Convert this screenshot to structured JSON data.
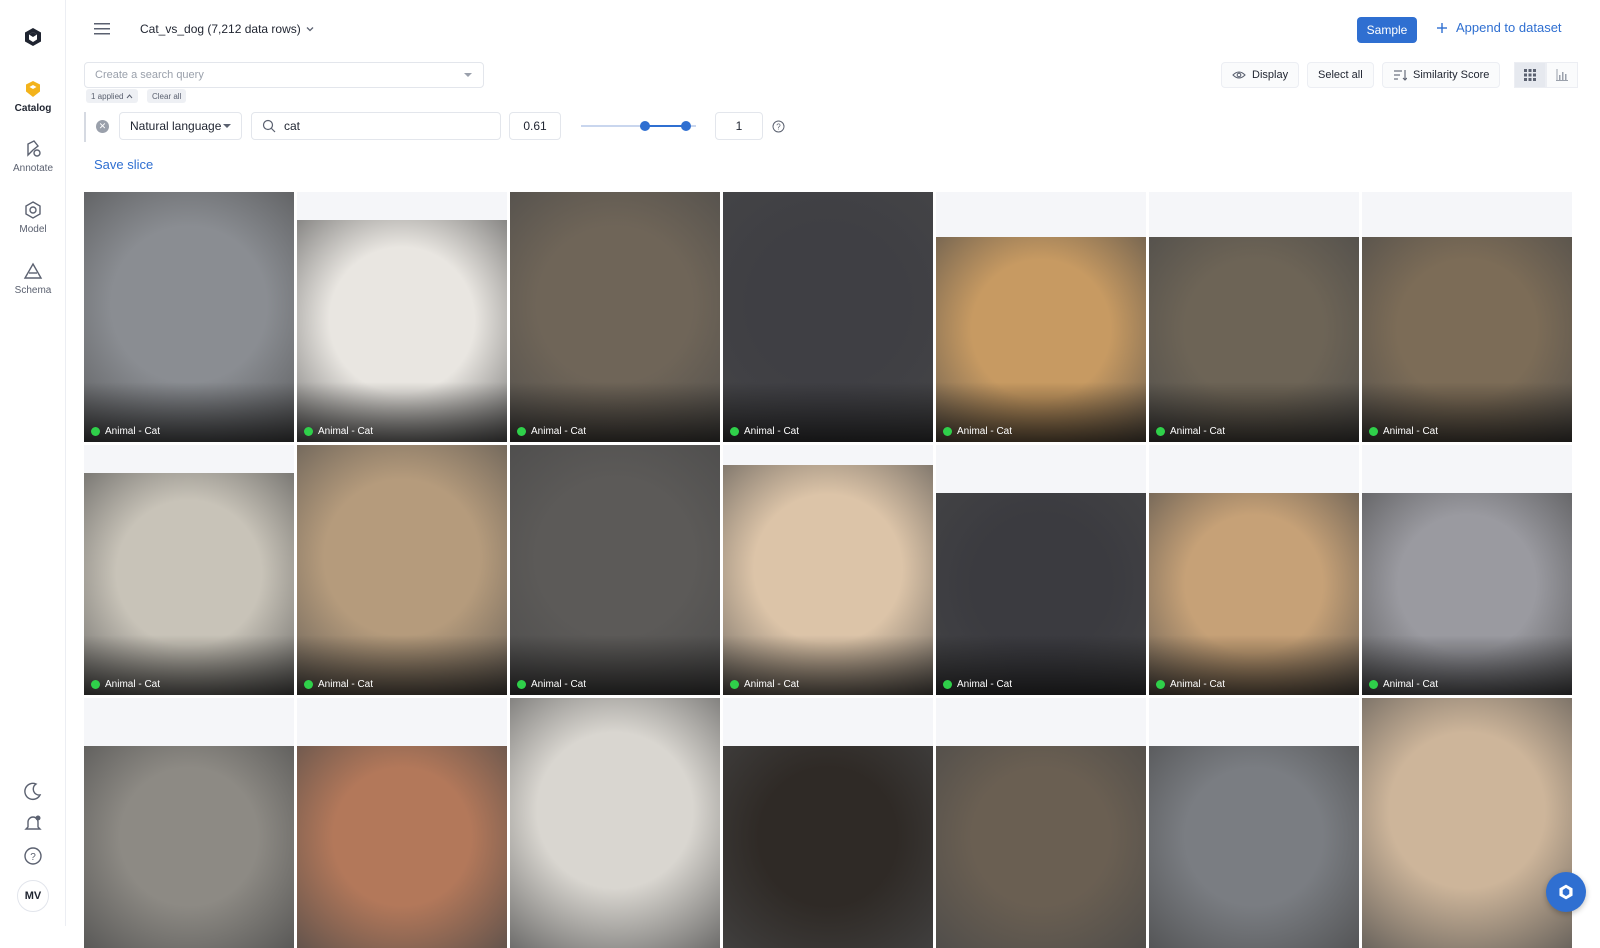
{
  "sidebar": {
    "items": [
      {
        "label": "Catalog",
        "icon": "catalog-icon",
        "active": true
      },
      {
        "label": "Annotate",
        "icon": "annotate-icon",
        "active": false
      },
      {
        "label": "Model",
        "icon": "model-icon",
        "active": false
      },
      {
        "label": "Schema",
        "icon": "schema-icon",
        "active": false
      }
    ],
    "bottom_icons": [
      "moon-icon",
      "bell-icon",
      "help-icon"
    ],
    "avatar": "MV"
  },
  "header": {
    "dataset_title": "Cat_vs_dog (7,212 data rows)",
    "sample_label": "Sample",
    "append_label": "Append to dataset"
  },
  "search": {
    "placeholder": "Create a search query",
    "applied_chip": "1 applied",
    "clear_chip": "Clear all"
  },
  "toolbar": {
    "display_label": "Display",
    "select_all_label": "Select all",
    "similarity_label": "Similarity Score"
  },
  "filter": {
    "type": "Natural language",
    "query": "cat",
    "threshold": "0.61",
    "max": "1",
    "slider_low": 0.56,
    "slider_high": 0.91
  },
  "save_slice_label": "Save slice",
  "grid": {
    "tiles": [
      {
        "label": "Animal - Cat",
        "color": "#8a8d92",
        "top": 0.0
      },
      {
        "label": "Animal - Cat",
        "color": "#e9e6e1",
        "top": 0.11
      },
      {
        "label": "Animal - Cat",
        "color": "#6f6558",
        "top": 0.0
      },
      {
        "label": "Animal - Cat",
        "color": "#3f3f44",
        "top": 0.0
      },
      {
        "label": "Animal - Cat",
        "color": "#c79a62",
        "top": 0.18
      },
      {
        "label": "Animal - Cat",
        "color": "#6d6456",
        "top": 0.18
      },
      {
        "label": "Animal - Cat",
        "color": "#7c6c57",
        "top": 0.18
      },
      {
        "label": "Animal - Cat",
        "color": "#c8c3b8",
        "top": 0.11
      },
      {
        "label": "Animal - Cat",
        "color": "#b59b7c",
        "top": 0.0
      },
      {
        "label": "Animal - Cat",
        "color": "#5c5a58",
        "top": 0.0
      },
      {
        "label": "Animal - Cat",
        "color": "#dcc4a8",
        "top": 0.08
      },
      {
        "label": "Animal - Cat",
        "color": "#3b3b40",
        "top": 0.19
      },
      {
        "label": "Animal - Cat",
        "color": "#c6a177",
        "top": 0.19
      },
      {
        "label": "Animal - Cat",
        "color": "#9a9aa0",
        "top": 0.19
      },
      {
        "label": "",
        "color": "#8d8a84",
        "top": 0.19
      },
      {
        "label": "",
        "color": "#b3785a",
        "top": 0.19
      },
      {
        "label": "",
        "color": "#d9d6d0",
        "top": 0.0
      },
      {
        "label": "",
        "color": "#2f2a26",
        "top": 0.19
      },
      {
        "label": "",
        "color": "#6a5f52",
        "top": 0.19
      },
      {
        "label": "",
        "color": "#7a7d82",
        "top": 0.19
      },
      {
        "label": "",
        "color": "#cdb59a",
        "top": 0.0
      }
    ]
  },
  "colors": {
    "accent": "#2f6fd1",
    "label_dot": "#2fd04a",
    "catalog_icon": "#f3b31b"
  }
}
